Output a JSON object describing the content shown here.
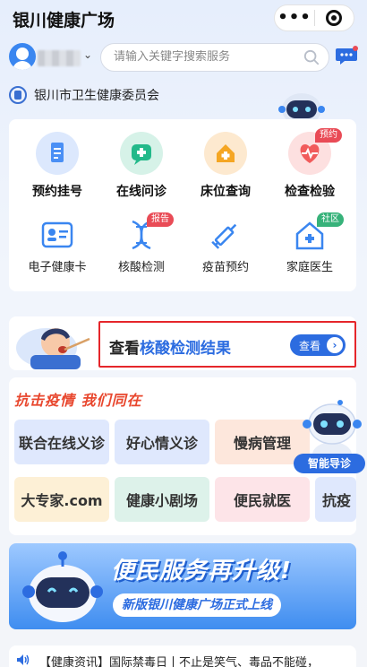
{
  "header": {
    "title": "银川健康广场",
    "more": "•••"
  },
  "search": {
    "placeholder": "请输入关键字搜索服务"
  },
  "org": {
    "name": "银川市卫生健康委员会"
  },
  "services_primary": [
    {
      "label": "预约挂号",
      "icon": "clipboard-icon",
      "color": "#4a8ff5"
    },
    {
      "label": "在线问诊",
      "icon": "consult-plus-icon",
      "color": "#23b98a"
    },
    {
      "label": "床位查询",
      "icon": "hospital-bed-icon",
      "color": "#f5a623"
    },
    {
      "label": "检查检验",
      "icon": "heart-monitor-icon",
      "color": "#f15b5b",
      "tag": "预约"
    }
  ],
  "services_secondary": [
    {
      "label": "电子健康卡",
      "icon": "id-card-icon"
    },
    {
      "label": "核酸检测",
      "icon": "dna-icon",
      "tag": "报告"
    },
    {
      "label": "疫苗预约",
      "icon": "syringe-icon"
    },
    {
      "label": "家庭医生",
      "icon": "home-plus-icon",
      "tag": "社区"
    }
  ],
  "nucleic": {
    "prefix": "查看",
    "highlight": "核酸检测结果",
    "button": "查看"
  },
  "epidemic": {
    "title": "抗击疫情 我们同在",
    "tiles_row1": [
      "联合在线义诊",
      "好心情义诊",
      "慢病管理"
    ],
    "tiles_row2": [
      "大专家.com",
      "健康小剧场",
      "便民就医",
      "抗疫"
    ]
  },
  "guide": {
    "label": "智能导诊"
  },
  "upgrade": {
    "title": "便民服务再升级!",
    "subtitle": "新版银川健康广场正式上线"
  },
  "news": {
    "text": "【健康资讯】国际禁毒日丨不止是笑气、毒品不能碰，"
  },
  "colors": {
    "accent": "#2c6ce0",
    "highlight_border": "#e5262b",
    "epidemic_title": "#e8472e"
  }
}
